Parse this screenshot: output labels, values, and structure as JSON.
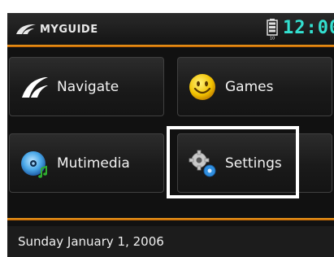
{
  "header": {
    "logo_text": "MYGUIDE",
    "clock": "12:00",
    "battery_icon": "battery-icon",
    "accent_color": "#33e0d0"
  },
  "menu": {
    "navigate": {
      "label": "Navigate",
      "icon": "navigate-swoosh-icon"
    },
    "games": {
      "label": "Games",
      "icon": "smiley-face-icon"
    },
    "multimedia": {
      "label": "Mutimedia",
      "icon": "cd-disc-icon"
    },
    "settings": {
      "label": "Settings",
      "icon": "gears-icon"
    }
  },
  "status": {
    "date": "Sunday January 1, 2006"
  }
}
